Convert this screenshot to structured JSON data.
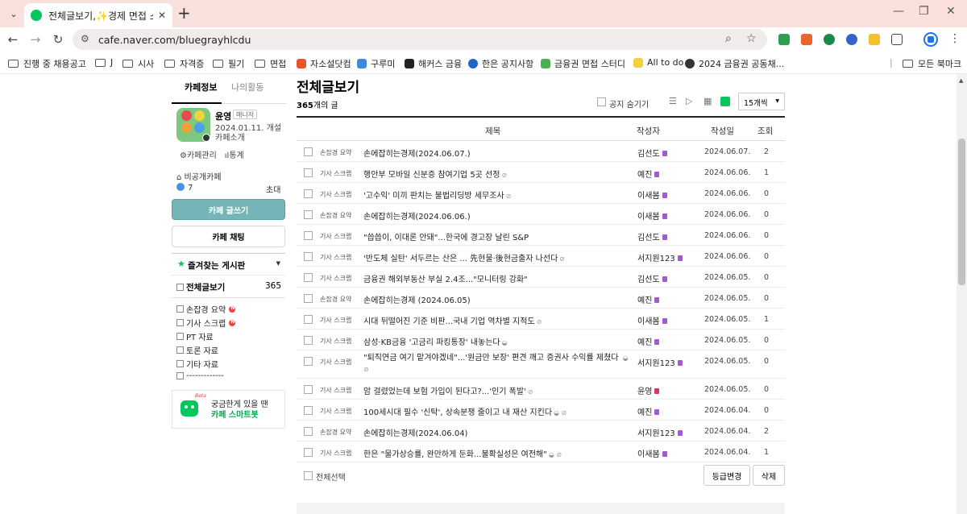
{
  "browser": {
    "tab_title": "전체글보기,✨경제 면접 스터디",
    "url": "cafe.naver.com/bluegrayhlcdu",
    "bookmarks": [
      {
        "label": "진행 중 채용공고",
        "type": "folder"
      },
      {
        "label": "J",
        "type": "folder"
      },
      {
        "label": "시사",
        "type": "folder"
      },
      {
        "label": "자격증",
        "type": "folder"
      },
      {
        "label": "필기",
        "type": "folder"
      },
      {
        "label": "면접",
        "type": "folder"
      },
      {
        "label": "자소설닷컴",
        "type": "site",
        "color": "#e8552c"
      },
      {
        "label": "구루미",
        "type": "site",
        "color": "#3a8be0"
      },
      {
        "label": "해커스 금융",
        "type": "site",
        "color": "#222222"
      },
      {
        "label": "한은 공지사항",
        "type": "site",
        "color": "#1f66c9"
      },
      {
        "label": "금융권 면접 스터디",
        "type": "site",
        "color": "#4caf50"
      },
      {
        "label": "All to do",
        "type": "site",
        "color": "#f2d23c"
      },
      {
        "label": "2024 금융권 공동채...",
        "type": "site",
        "color": "#333333"
      }
    ],
    "all_bookmarks_label": "모든 북마크"
  },
  "sidebar": {
    "tab_cafe_info": "카페정보",
    "tab_my_activity": "나의활동",
    "cafe_name": "윤영",
    "manager_badge": "매니저",
    "open_date": "2024.01.11. 개설",
    "cafe_intro": "카페소개",
    "manage_link": "카페관리",
    "stats_link": "통계",
    "privacy": "비공개카페",
    "member_count": "7",
    "invite": "초대",
    "write_button": "카페 글쓰기",
    "chat_button": "카페 채팅",
    "favorites_title": "즐겨찾는 게시판",
    "all_posts_label": "전체글보기",
    "all_posts_count": "365",
    "boards": [
      {
        "label": "손잡경 요약",
        "new": true
      },
      {
        "label": "기사 스크랩",
        "new": true
      },
      {
        "label": "PT 자료",
        "new": false
      },
      {
        "label": "토론 자료",
        "new": false
      },
      {
        "label": "기타 자료",
        "new": false
      },
      {
        "label": "-------------",
        "new": false
      }
    ],
    "chatbot_beta": "Beta",
    "chatbot_line1": "궁금한게 있을 땐",
    "chatbot_line2": "카페 스마트봇"
  },
  "main": {
    "title": "전체글보기",
    "count_number": "365",
    "count_suffix": "개의 글",
    "hide_notice_label": "공지 숨기기",
    "per_page": "15개씩",
    "columns": {
      "title": "제목",
      "author": "작성자",
      "date": "작성일",
      "views": "조회"
    },
    "posts": [
      {
        "category": "손잡경 요약",
        "title": "손에잡히는경제(2024.06.07.)",
        "mark": "",
        "author": "김선도",
        "badge": "purple",
        "date": "2024.06.07.",
        "views": "2"
      },
      {
        "category": "기사 스크랩",
        "title": "행안부 모바일 신분증 참여기업 5곳 선정",
        "mark": "⊘",
        "author": "예진",
        "badge": "purple",
        "date": "2024.06.06.",
        "views": "1"
      },
      {
        "category": "기사 스크랩",
        "title": "'고수익' 미끼 판치는 불법리딩방 세무조사",
        "mark": "⊘",
        "author": "이새봄",
        "badge": "purple",
        "date": "2024.06.06.",
        "views": "0"
      },
      {
        "category": "손잡경 요약",
        "title": "손에잡히는경제(2024.06.06.)",
        "mark": "",
        "author": "이새봄",
        "badge": "purple",
        "date": "2024.06.06.",
        "views": "0"
      },
      {
        "category": "기사 스크랩",
        "title": "\"씁씁이, 이대론 안돼\"...한국에 경고장 날린 S&P",
        "mark": "",
        "author": "김선도",
        "badge": "purple",
        "date": "2024.06.06.",
        "views": "0"
      },
      {
        "category": "기사 스크랩",
        "title": "'반도체 실탄' 서두르는 산은 ... 先현물·後현금출자 나선다",
        "mark": "⊘",
        "author": "서지원123",
        "badge": "purple",
        "date": "2024.06.06.",
        "views": "0"
      },
      {
        "category": "기사 스크랩",
        "title": "금융권 해외부동산 부실 2.4조...\"모니터링 강화\"",
        "mark": "",
        "author": "김선도",
        "badge": "purple",
        "date": "2024.06.05.",
        "views": "0"
      },
      {
        "category": "손잡경 요약",
        "title": "손에잡히는경제 (2024.06.05)",
        "mark": "",
        "author": "예진",
        "badge": "purple",
        "date": "2024.06.05.",
        "views": "0"
      },
      {
        "category": "기사 스크랩",
        "title": "시대 뒤떨어진 기준 비판...국내 기업 역차별 지적도",
        "mark": "⊘",
        "author": "이새봄",
        "badge": "purple",
        "date": "2024.06.05.",
        "views": "1"
      },
      {
        "category": "기사 스크랩",
        "title": "삼성·KB금융 '고금리 파킹통장' 내놓는다",
        "mark": "◒",
        "author": "예진",
        "badge": "purple",
        "date": "2024.06.05.",
        "views": "0"
      },
      {
        "category": "기사 스크랩",
        "title": "\"퇴직연금 여기 맡겨야겠네\"...'원금만 보장' 편견 깨고 증권사 수익률 제쳤다",
        "mark": "◒ ⊘",
        "author": "서지원123",
        "badge": "purple",
        "date": "2024.06.05.",
        "views": "0",
        "wrap": true
      },
      {
        "category": "기사 스크랩",
        "title": "암 걸렸었는데 보험 가입이 된다고?...'인기 폭발'",
        "mark": "⊘",
        "author": "윤영",
        "badge": "red",
        "date": "2024.06.05.",
        "views": "0"
      },
      {
        "category": "기사 스크랩",
        "title": "100세시대 필수 '신탁', 상속분쟁 줄이고 내 재산 지킨다",
        "mark": "◒ ⊘",
        "author": "예진",
        "badge": "purple",
        "date": "2024.06.04.",
        "views": "0"
      },
      {
        "category": "손잡경 요약",
        "title": "손에잡히는경제(2024.06.04)",
        "mark": "",
        "author": "서지원123",
        "badge": "purple",
        "date": "2024.06.04.",
        "views": "2"
      },
      {
        "category": "기사 스크랩",
        "title": "한은 \"물가상승률, 완만하게 둔화...불확실성은 여전해\"",
        "mark": "◒ ⊘",
        "author": "이새봄",
        "badge": "purple",
        "date": "2024.06.04.",
        "views": "1"
      }
    ],
    "select_all": "전체선택",
    "grade_button": "등급변경",
    "delete_button": "삭제"
  }
}
